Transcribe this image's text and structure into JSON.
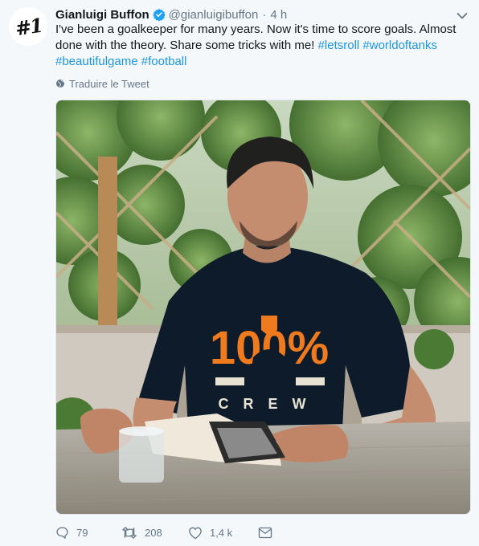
{
  "tweet": {
    "author": {
      "name": "Gianluigi Buffon",
      "handle": "@gianluigibuffon",
      "avatar_text": "#1",
      "verified_color": "#1da1f2"
    },
    "separator": "·",
    "time": "4 h",
    "text_parts": {
      "line1": "I've been a goalkeeper for many years. Now it's time to score goals. Almost",
      "line2": "done with the theory. Share some tricks with me!",
      "hashtag1": "#letsroll",
      "hashtag2": "#worldoftanks",
      "hashtag3": "#beautifulgame",
      "hashtag4": "#football"
    },
    "translate_label": "Traduire le Tweet",
    "image": {
      "shirt_text_1": "100%",
      "shirt_text_2": "CREW"
    },
    "actions": {
      "replies": "79",
      "retweets": "208",
      "likes": "1,4 k"
    },
    "colors": {
      "accent": "#1b95e0",
      "muted": "#657786",
      "shirt_orange": "#f07a1e"
    },
    "icons": [
      "verified-badge-icon",
      "chevron-down-icon",
      "globe-icon",
      "reply-icon",
      "retweet-icon",
      "like-icon",
      "direct-message-icon"
    ]
  }
}
